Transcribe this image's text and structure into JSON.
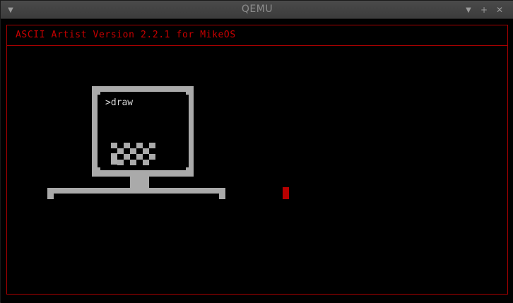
{
  "window": {
    "title": "QEMU",
    "menu_icon": "chevron-down-icon",
    "minimize_icon": "minimize-icon",
    "maximize_icon": "maximize-icon",
    "close_icon": "close-icon"
  },
  "app": {
    "header": "ASCII Artist Version 2.2.1 for MikeOS",
    "accent_color": "#c80000",
    "drawing_color": "#aaaaaa"
  },
  "drawing": {
    "monitor_text": ">draw"
  }
}
